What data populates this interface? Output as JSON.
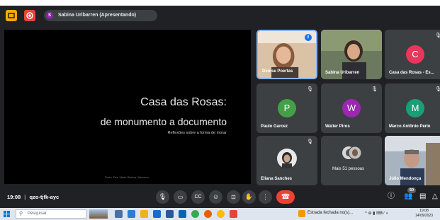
{
  "topbar": {
    "presenter_initial": "S",
    "presenter_label": "Sabina Uribarren (Apresentando)"
  },
  "slide": {
    "title_line1": "Casa das Rosas:",
    "title_line2": "de monumento a documento",
    "subtitle": "Reflexões sobre a forma de morar",
    "footer": "Profa. Dra. Maria Sabina Uribarren"
  },
  "participants": [
    {
      "name": "Denise Poertas",
      "type": "photo",
      "muted": false,
      "speaking": true
    },
    {
      "name": "Sabina Uribarren",
      "type": "photo",
      "muted": false
    },
    {
      "name": "Casa das Rosas - Es...",
      "initial": "C",
      "color": "#e8365d",
      "muted": true
    },
    {
      "name": "Paulo Garcez",
      "initial": "P",
      "color": "#43a047",
      "muted": true
    },
    {
      "name": "Walter Piros",
      "initial": "W",
      "color": "#9c27b0",
      "muted": true
    },
    {
      "name": "Marco Antônio Perin",
      "initial": "M",
      "color": "#1b9e77",
      "muted": true
    },
    {
      "name": "Eliana Sanches",
      "type": "photo",
      "muted": true
    },
    {
      "name": "Mais 51 pessoas",
      "type": "group"
    },
    {
      "name": "Júlio Mendonça",
      "type": "photo"
    }
  ],
  "controls": {
    "time": "19:08",
    "separator": "|",
    "meeting_code": "qzo-tjfk-ayc",
    "participant_count": "60"
  },
  "taskbar": {
    "search_placeholder": "Pesquisar",
    "notification": "Estrada fechada no(s)...",
    "tray_icons": "^ ⊕ ▮ ⌨ ⁄ ◖",
    "clock_time": "19:08",
    "clock_date": "14/09/2023"
  },
  "icons": [
    "presentation-icon",
    "record-icon",
    "mic-off-icon",
    "mic-icon",
    "camera-icon",
    "captions-icon",
    "emoji-icon",
    "present-icon",
    "raise-hand-icon",
    "more-icon",
    "end-call-icon",
    "info-icon",
    "people-icon",
    "chat-icon",
    "activities-icon",
    "windows-icon",
    "search-icon"
  ]
}
